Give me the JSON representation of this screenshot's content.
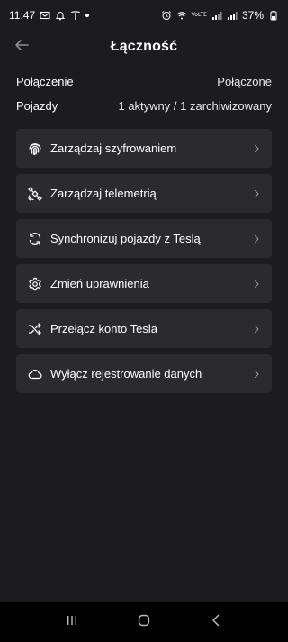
{
  "status_bar": {
    "time": "11:47",
    "battery": "37%",
    "network_label_top": "VoLTE",
    "left_icons": [
      "mail-icon",
      "alarm-bell-icon",
      "tesla-logo-icon",
      "notification-dot"
    ],
    "right_icons": [
      "alarm-clock-icon",
      "wifi-icon",
      "signal-icon",
      "signal-icon-2",
      "battery-icon"
    ]
  },
  "header": {
    "title": "Łączność",
    "back_icon": "arrow-left-icon"
  },
  "info": {
    "connection_label": "Połączenie",
    "connection_value": "Połączone",
    "vehicles_label": "Pojazdy",
    "vehicles_value": "1 aktywny / 1 zarchiwizowany"
  },
  "menu": {
    "items": [
      {
        "label": "Zarządzaj szyfrowaniem",
        "icon": "fingerprint-icon"
      },
      {
        "label": "Zarządzaj telemetrią",
        "icon": "satellite-icon"
      },
      {
        "label": "Synchronizuj pojazdy z Teslą",
        "icon": "sync-icon"
      },
      {
        "label": "Zmień uprawnienia",
        "icon": "gear-icon"
      },
      {
        "label": "Przełącz konto Tesla",
        "icon": "shuffle-icon"
      },
      {
        "label": "Wyłącz rejestrowanie danych",
        "icon": "cloud-icon"
      }
    ]
  },
  "nav_bar": {
    "buttons": [
      "recent-apps-icon",
      "home-icon",
      "back-icon"
    ]
  },
  "colors": {
    "background": "#1c1b1f",
    "card": "#2b2a2f",
    "nav_bar": "#000000",
    "text": "#ffffff"
  }
}
